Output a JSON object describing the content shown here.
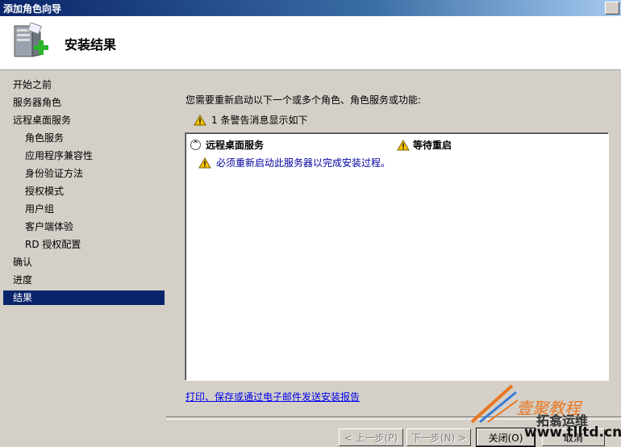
{
  "window": {
    "title": "添加角色向导"
  },
  "header": {
    "title": "安装结果",
    "icon": "server-add-icon"
  },
  "nav": {
    "items": [
      {
        "label": "开始之前",
        "sub": false,
        "active": false
      },
      {
        "label": "服务器角色",
        "sub": false,
        "active": false
      },
      {
        "label": "远程桌面服务",
        "sub": false,
        "active": false
      },
      {
        "label": "角色服务",
        "sub": true,
        "active": false
      },
      {
        "label": "应用程序兼容性",
        "sub": true,
        "active": false
      },
      {
        "label": "身份验证方法",
        "sub": true,
        "active": false
      },
      {
        "label": "授权模式",
        "sub": true,
        "active": false
      },
      {
        "label": "用户组",
        "sub": true,
        "active": false
      },
      {
        "label": "客户端体验",
        "sub": true,
        "active": false
      },
      {
        "label": "RD 授权配置",
        "sub": true,
        "active": false
      },
      {
        "label": "确认",
        "sub": false,
        "active": false
      },
      {
        "label": "进度",
        "sub": false,
        "active": false
      },
      {
        "label": "结果",
        "sub": false,
        "active": true
      }
    ]
  },
  "main": {
    "message": "您需要重新启动以下一个或多个角色、角色服务或功能:",
    "warning_summary": "1 条警告消息显示如下",
    "result": {
      "role": "远程桌面服务",
      "status": "等待重启",
      "detail": "必须重新启动此服务器以完成安装过程。"
    },
    "report_link": "打印、保存或通过电子邮件发送安装报告"
  },
  "buttons": {
    "prev": "< 上一步(P)",
    "next": "下一步(N) >",
    "close": "关闭(O)",
    "cancel": "取消"
  },
  "watermark": {
    "line1": "壹聚教程",
    "line2": "拓翕运维",
    "line3": "www.tlltd.cn"
  },
  "colors": {
    "accent": "#0a246a",
    "warning": "#f5c400",
    "link": "#0000ee"
  }
}
